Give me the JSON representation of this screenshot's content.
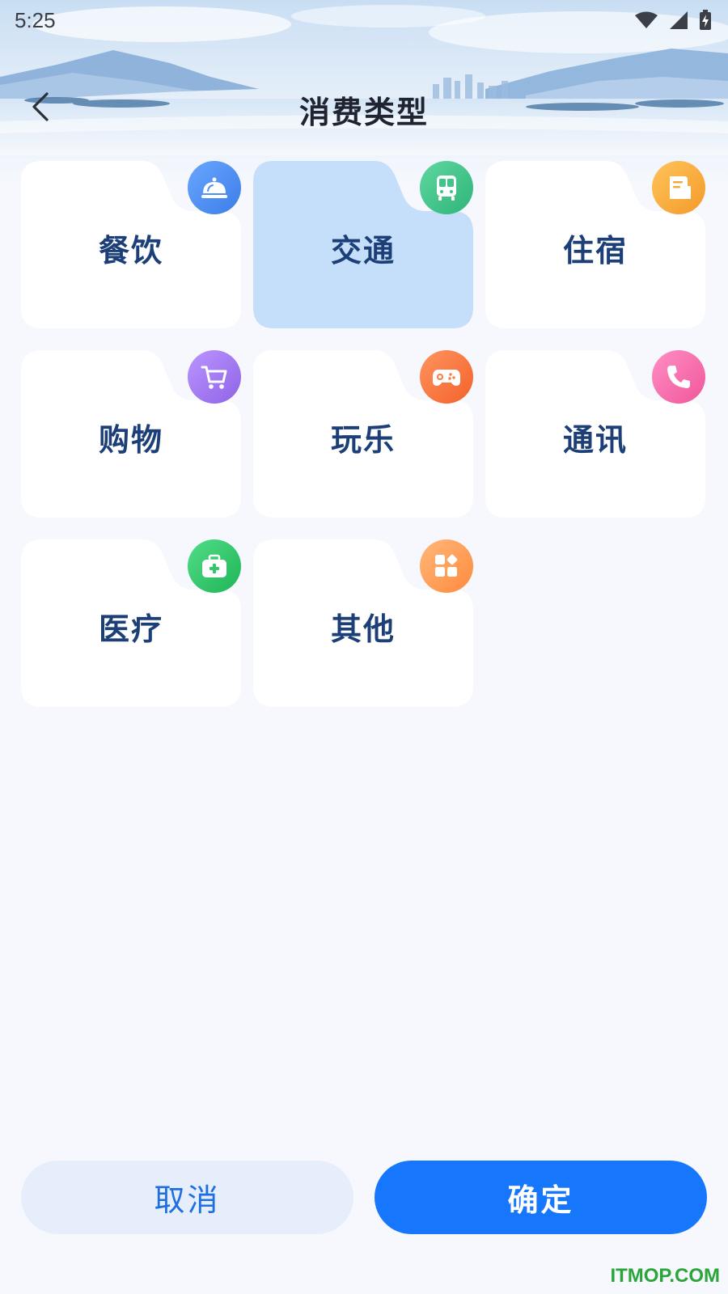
{
  "status_bar": {
    "time": "5:25",
    "icons": [
      "wifi-icon",
      "signal-icon",
      "battery-charging-icon"
    ]
  },
  "header": {
    "title": "消费类型",
    "back_icon": "chevron-left-icon"
  },
  "categories": [
    {
      "label": "餐饮",
      "icon": "food-cloche-icon",
      "color": "#4f8ef0",
      "selected": false
    },
    {
      "label": "交通",
      "icon": "bus-icon",
      "color": "#3fc48a",
      "selected": true
    },
    {
      "label": "住宿",
      "icon": "document-icon",
      "color": "#f5a93a",
      "selected": false
    },
    {
      "label": "购物",
      "icon": "shopping-cart-icon",
      "color": "#a57ef0",
      "selected": false
    },
    {
      "label": "玩乐",
      "icon": "gamepad-icon",
      "color": "#ff7a3f",
      "selected": false
    },
    {
      "label": "通讯",
      "icon": "phone-icon",
      "color": "#ff6fb0",
      "selected": false
    },
    {
      "label": "医疗",
      "icon": "medical-kit-icon",
      "color": "#2fc96a",
      "selected": false
    },
    {
      "label": "其他",
      "icon": "apps-grid-icon",
      "color": "#ff9e52",
      "selected": false
    }
  ],
  "footer": {
    "cancel_label": "取消",
    "confirm_label": "确定"
  },
  "watermark": "ITMOP.COM",
  "colors": {
    "primary": "#1677fc",
    "selected_card": "#c5defa",
    "card": "#ffffff",
    "label_text": "#1d3f77"
  }
}
